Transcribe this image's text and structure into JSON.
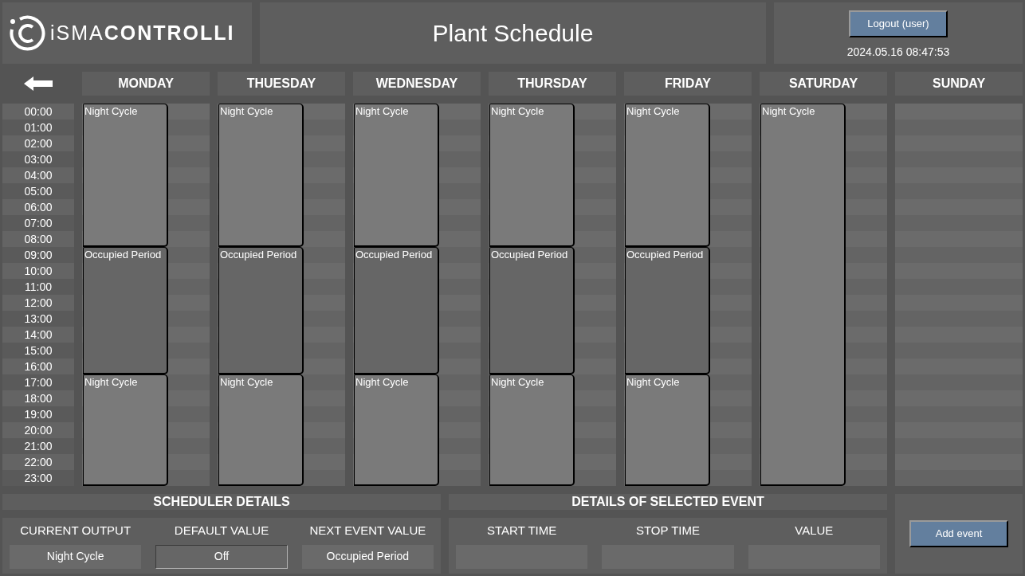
{
  "logo": {
    "text": "iSMA**CONTROLLI**"
  },
  "title": "Plant Schedule",
  "logout_button": "Logout (user)",
  "datetime": "2024.05.16 08:47:53",
  "hours": [
    "00:00",
    "01:00",
    "02:00",
    "03:00",
    "04:00",
    "05:00",
    "06:00",
    "07:00",
    "08:00",
    "09:00",
    "10:00",
    "11:00",
    "12:00",
    "13:00",
    "14:00",
    "15:00",
    "16:00",
    "17:00",
    "18:00",
    "19:00",
    "20:00",
    "21:00",
    "22:00",
    "23:00"
  ],
  "days": [
    {
      "name": "MONDAY",
      "events": [
        {
          "label": "Night Cycle",
          "kind": "night"
        },
        {
          "label": "Occupied Period",
          "kind": "occupied"
        },
        {
          "label": "Night Cycle",
          "kind": "night"
        }
      ]
    },
    {
      "name": "THUESDAY",
      "events": [
        {
          "label": "Night Cycle",
          "kind": "night"
        },
        {
          "label": "Occupied Period",
          "kind": "occupied"
        },
        {
          "label": "Night Cycle",
          "kind": "night"
        }
      ]
    },
    {
      "name": "WEDNESDAY",
      "events": [
        {
          "label": "Night Cycle",
          "kind": "night"
        },
        {
          "label": "Occupied Period",
          "kind": "occupied"
        },
        {
          "label": "Night Cycle",
          "kind": "night"
        }
      ]
    },
    {
      "name": "THURSDAY",
      "events": [
        {
          "label": "Night Cycle",
          "kind": "night"
        },
        {
          "label": "Occupied Period",
          "kind": "occupied"
        },
        {
          "label": "Night Cycle",
          "kind": "night"
        }
      ]
    },
    {
      "name": "FRIDAY",
      "events": [
        {
          "label": "Night Cycle",
          "kind": "night"
        },
        {
          "label": "Occupied Period",
          "kind": "occupied"
        },
        {
          "label": "Night Cycle",
          "kind": "night"
        }
      ]
    },
    {
      "name": "SATURDAY",
      "events": [
        {
          "label": "Night Cycle",
          "kind": "night"
        }
      ]
    },
    {
      "name": "SUNDAY"
    }
  ],
  "scheduler_details": {
    "heading": "SCHEDULER DETAILS",
    "fields": [
      {
        "label": "CURRENT OUTPUT",
        "value": "Night Cycle",
        "kind": "display"
      },
      {
        "label": "DEFAULT VALUE",
        "value": "Off",
        "kind": "select"
      },
      {
        "label": "NEXT EVENT VALUE",
        "value": "Occupied Period",
        "kind": "display"
      }
    ]
  },
  "selected_event": {
    "heading": "DETAILS OF SELECTED EVENT",
    "fields": [
      {
        "label": "START TIME"
      },
      {
        "label": "STOP TIME"
      },
      {
        "label": "VALUE"
      }
    ]
  },
  "add_event_button": "Add event"
}
